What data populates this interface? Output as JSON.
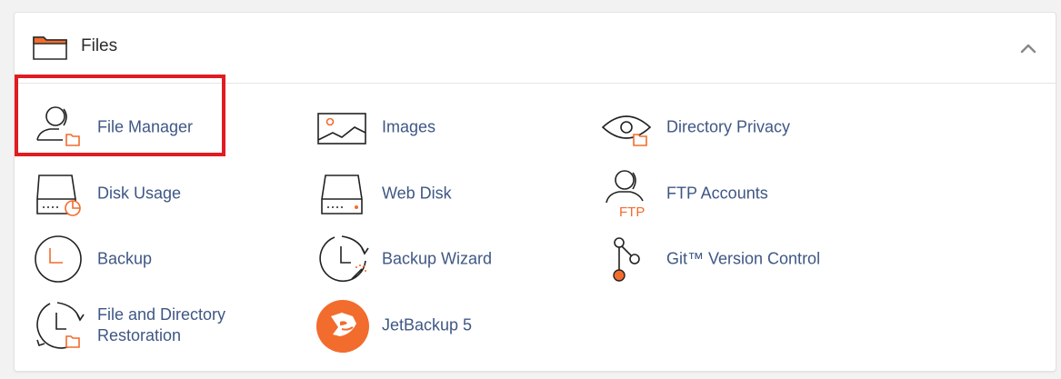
{
  "section": {
    "title": "Files",
    "collapse_icon": "chevron-up-icon"
  },
  "colors": {
    "accent": "#f26c2d",
    "link": "#3f5785",
    "highlight": "#e11b22"
  },
  "items": [
    {
      "label": "File Manager",
      "icon": "file-manager-icon"
    },
    {
      "label": "Images",
      "icon": "images-icon"
    },
    {
      "label": "Directory Privacy",
      "icon": "directory-privacy-icon"
    },
    {
      "label": "Disk Usage",
      "icon": "disk-usage-icon"
    },
    {
      "label": "Web Disk",
      "icon": "web-disk-icon"
    },
    {
      "label": "FTP Accounts",
      "icon": "ftp-accounts-icon"
    },
    {
      "label": "Backup",
      "icon": "backup-icon"
    },
    {
      "label": "Backup Wizard",
      "icon": "backup-wizard-icon"
    },
    {
      "label": "Git™ Version Control",
      "icon": "git-icon"
    },
    {
      "label": "File and Directory Restoration",
      "icon": "restoration-icon"
    },
    {
      "label": "JetBackup 5",
      "icon": "jetbackup-icon"
    }
  ],
  "icon_labels": {
    "ftp": "FTP"
  }
}
